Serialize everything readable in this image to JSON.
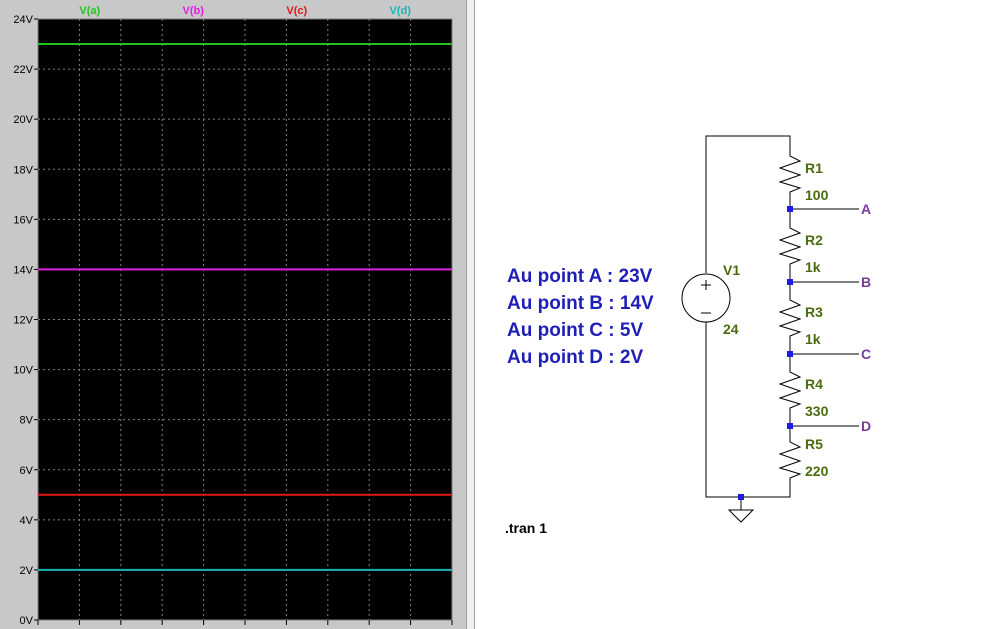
{
  "plot": {
    "background": "#000000",
    "grid_color": "#7f7f7f",
    "chart_data": {
      "type": "line",
      "ylim": [
        0,
        24
      ],
      "y_ticks": [
        0,
        2,
        4,
        6,
        8,
        10,
        12,
        14,
        16,
        18,
        20,
        22,
        24
      ],
      "y_tick_labels": [
        "0V",
        "2V",
        "4V",
        "6V",
        "8V",
        "10V",
        "12V",
        "14V",
        "16V",
        "18V",
        "20V",
        "22V",
        "24V"
      ],
      "x_grid_count": 11,
      "series": [
        {
          "name": "V(a)",
          "value": 23,
          "color": "#22c322"
        },
        {
          "name": "V(b)",
          "value": 14,
          "color": "#e020e0"
        },
        {
          "name": "V(c)",
          "value": 5,
          "color": "#e01818"
        },
        {
          "name": "V(d)",
          "value": 2,
          "color": "#18b4b4"
        }
      ]
    }
  },
  "schematic": {
    "wire_color": "#000000",
    "component_color": "#000000",
    "junction_color": "#1c1ce0",
    "notes": [
      "Au point A : 23V",
      "Au point B : 14V",
      "Au point C : 5V",
      "Au point D : 2V"
    ],
    "source": {
      "name": "V1",
      "value": "24"
    },
    "resistors": [
      {
        "name": "R1",
        "value": "100"
      },
      {
        "name": "R2",
        "value": "1k"
      },
      {
        "name": "R3",
        "value": "1k"
      },
      {
        "name": "R4",
        "value": "330"
      },
      {
        "name": "R5",
        "value": "220"
      }
    ],
    "nets": [
      "A",
      "B",
      "C",
      "D"
    ],
    "directive": ".tran 1"
  }
}
